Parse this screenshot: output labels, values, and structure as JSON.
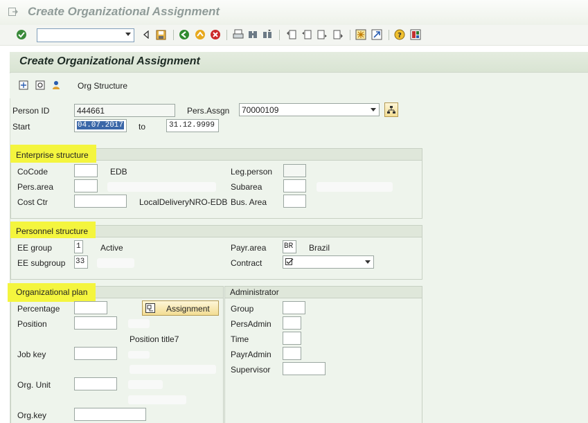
{
  "window": {
    "title": "Create Organizational Assignment"
  },
  "screen": {
    "title": "Create Organizational Assignment"
  },
  "app_toolbar": {
    "org_structure_label": "Org Structure"
  },
  "header": {
    "person_id_label": "Person ID",
    "person_id_value": "444661",
    "pers_assgn_label": "Pers.Assgn",
    "pers_assgn_value": "70000109",
    "start_label": "Start",
    "start_value": "04.07.2017",
    "to_label": "to",
    "end_value": "31.12.9999"
  },
  "enterprise": {
    "title": "Enterprise structure",
    "cocode_label": "CoCode",
    "cocode_text": "EDB",
    "pers_area_label": "Pers.area",
    "cost_ctr_label": "Cost Ctr",
    "cost_ctr_text": "LocalDeliveryNRO-EDB",
    "leg_person_label": "Leg.person",
    "subarea_label": "Subarea",
    "bus_area_label": "Bus. Area"
  },
  "personnel": {
    "title": "Personnel structure",
    "ee_group_label": "EE group",
    "ee_group_value": "1",
    "ee_group_text": "Active",
    "ee_subgroup_label": "EE subgroup",
    "ee_subgroup_value": "33",
    "payr_area_label": "Payr.area",
    "payr_area_value": "BR",
    "payr_area_text": "Brazil",
    "contract_label": "Contract"
  },
  "org_plan": {
    "title": "Organizational plan",
    "percentage_label": "Percentage",
    "assignment_button": "Assignment",
    "position_label": "Position",
    "position_title": "Position title7",
    "job_key_label": "Job key",
    "org_unit_label": "Org. Unit",
    "org_key_label": "Org.key"
  },
  "administrator": {
    "title": "Administrator",
    "group_label": "Group",
    "pers_admin_label": "PersAdmin",
    "time_label": "Time",
    "payr_admin_label": "PayrAdmin",
    "supervisor_label": "Supervisor"
  },
  "colors": {
    "highlight": "#f4f53e",
    "panel": "#eef4ec",
    "selection": "#3b67a8"
  }
}
